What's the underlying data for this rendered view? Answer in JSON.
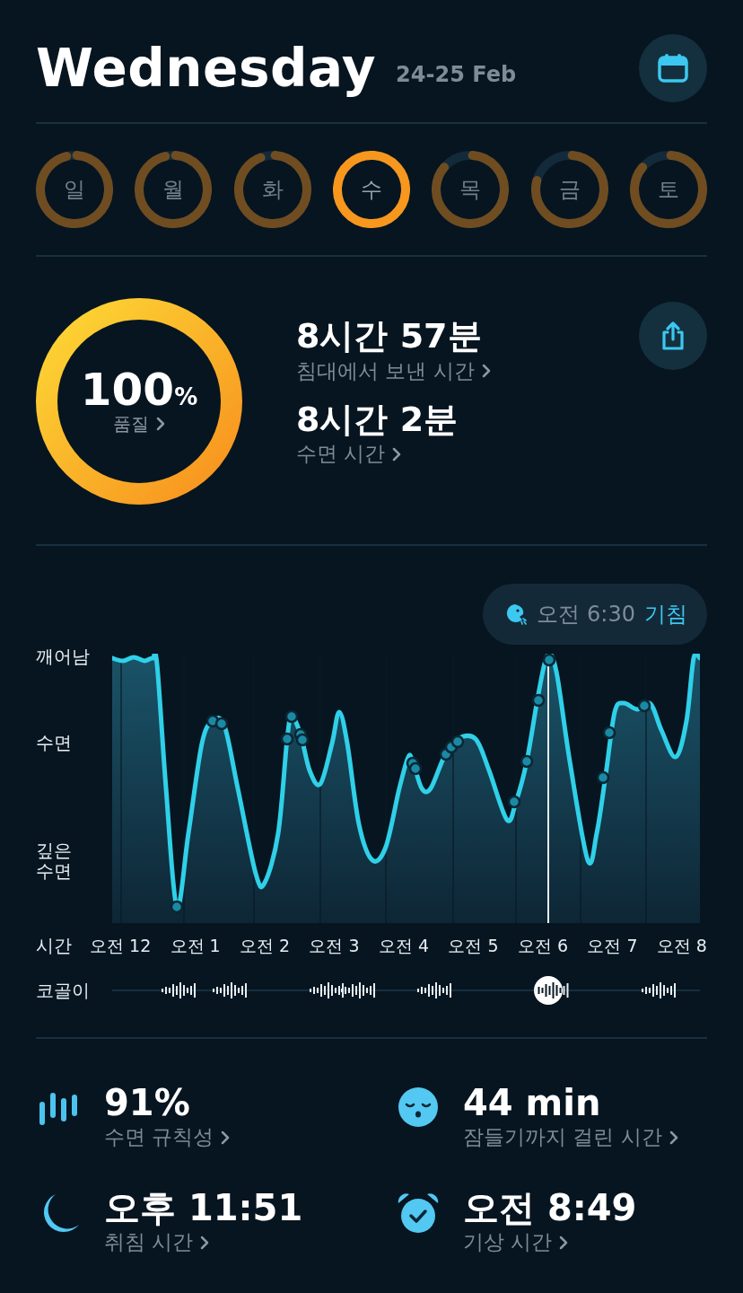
{
  "header": {
    "title": "Wednesday",
    "date_range": "24-25 Feb"
  },
  "days": [
    {
      "label": "일",
      "selected": false
    },
    {
      "label": "월",
      "selected": false
    },
    {
      "label": "화",
      "selected": false
    },
    {
      "label": "수",
      "selected": true
    },
    {
      "label": "목",
      "selected": false
    },
    {
      "label": "금",
      "selected": false
    },
    {
      "label": "토",
      "selected": false
    }
  ],
  "quality": {
    "value": "100",
    "unit": "%",
    "label": "품질"
  },
  "durations": [
    {
      "value": "8시간 57분",
      "label": "침대에서 보낸 시간"
    },
    {
      "value": "8시간 2분",
      "label": "수면 시간"
    }
  ],
  "graph": {
    "event": {
      "time": "오전 6:30",
      "label": "기침"
    },
    "y_labels": [
      "깨어남",
      "수면",
      "깊은 수면"
    ],
    "x_axis_label": "시간",
    "x_labels": [
      "오전 12",
      "오전 1",
      "오전 2",
      "오전 3",
      "오전 4",
      "오전 5",
      "오전 6",
      "오전 7",
      "오전 8"
    ],
    "snore_label": "코골이"
  },
  "stats": [
    {
      "kind": "regularity",
      "value": "91%",
      "label": "수면 규칙성"
    },
    {
      "kind": "latency",
      "value": "44 min",
      "label": "잠들기까지 걸린 시간"
    },
    {
      "kind": "bedtime",
      "value": "오후 11:51",
      "label": "취침 시간"
    },
    {
      "kind": "wake",
      "value": "오전 8:49",
      "label": "기상 시간"
    }
  ]
}
